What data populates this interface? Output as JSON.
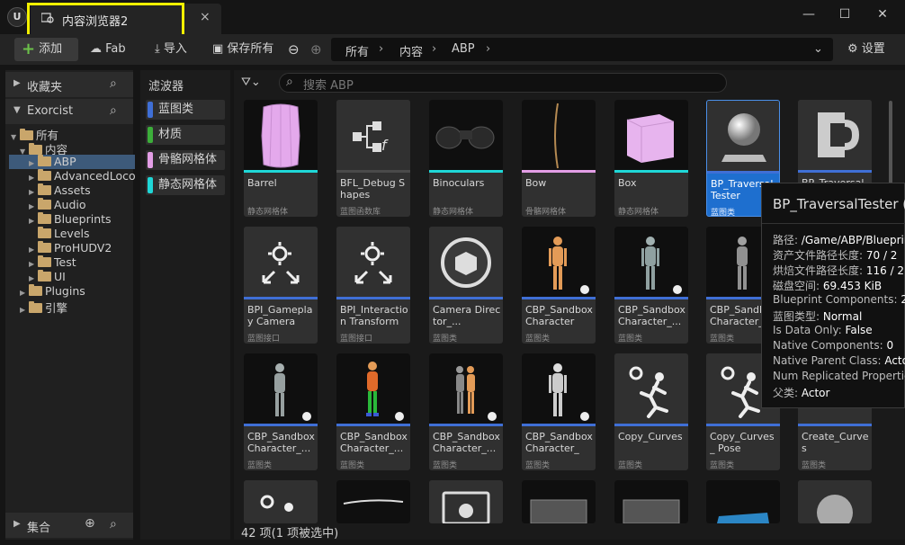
{
  "tab": {
    "label": "内容浏览器2",
    "close": "×"
  },
  "window": {
    "minimize": "—",
    "maximize": "☐",
    "close": "✕"
  },
  "toolbar": {
    "add": "添加",
    "fab": "Fab",
    "import": "导入",
    "save_all": "保存所有",
    "settings": "设置"
  },
  "breadcrumb": [
    "所有",
    "内容",
    "ABP"
  ],
  "left": {
    "favorites": "收藏夹",
    "project": "Exorcist",
    "tree": [
      "所有",
      "内容",
      "ABP",
      "AdvancedLoco",
      "Assets",
      "Audio",
      "Blueprints",
      "Levels",
      "ProHUDV2",
      "Test",
      "UI",
      "Plugins",
      "引擎"
    ],
    "collections": "集合"
  },
  "filters": {
    "title": "滤波器",
    "items": [
      {
        "label": "蓝图类",
        "color": "#3f6fd6"
      },
      {
        "label": "材质",
        "color": "#3cae3a"
      },
      {
        "label": "骨骼网格体",
        "color": "#e39ee6"
      },
      {
        "label": "静态网格体",
        "color": "#1fd7d7"
      }
    ]
  },
  "search": {
    "placeholder": "搜索 ABP"
  },
  "assets": [
    {
      "name": "Barrel",
      "type": "静态网格体"
    },
    {
      "name": "BFL_Debug Shapes",
      "type": "蓝图函数库"
    },
    {
      "name": "Binoculars",
      "type": "静态网格体"
    },
    {
      "name": "Bow",
      "type": "骨骼网格体"
    },
    {
      "name": "Box",
      "type": "静态网格体"
    },
    {
      "name": "BP_Traversal Tester",
      "type": "蓝图类"
    },
    {
      "name": "BP_Traversal",
      "type": ""
    },
    {
      "name": "BPI_Gameplay Camera",
      "type": "蓝图接口"
    },
    {
      "name": "BPI_Interaction Transform",
      "type": "蓝图接口"
    },
    {
      "name": "Camera Director_...",
      "type": "蓝图类"
    },
    {
      "name": "CBP_Sandbox Character",
      "type": "蓝图类"
    },
    {
      "name": "CBP_Sandbox Character_...",
      "type": "蓝图类"
    },
    {
      "name": "CBP_Sandbox Character_...",
      "type": "蓝图类"
    },
    {
      "name": "CBP_Sandbox Character_...",
      "type": "蓝图类"
    },
    {
      "name": "CBP_Sandbox Character_...",
      "type": "蓝图类"
    },
    {
      "name": "CBP_Sandbox Character_...",
      "type": "蓝图类"
    },
    {
      "name": "CBP_Sandbox Character_U...",
      "type": "蓝图类"
    },
    {
      "name": "Copy_Curves",
      "type": "蓝图类"
    },
    {
      "name": "Copy_Curves_ Pose",
      "type": "蓝图类"
    },
    {
      "name": "Create_Curves",
      "type": "蓝图类"
    }
  ],
  "tooltip": {
    "title": "BP_TraversalTester (",
    "rows": [
      {
        "k": "路径: ",
        "v": "/Game/ABP/Blueprin"
      },
      {
        "k": "资产文件路径长度: ",
        "v": "70 / 2"
      },
      {
        "k": "烘焙文件路径长度: ",
        "v": "116 / 2"
      },
      {
        "k": "磁盘空间: ",
        "v": "69.453 KiB"
      },
      {
        "k": "Blueprint Components: ",
        "v": "2"
      },
      {
        "k": "蓝图类型: ",
        "v": "Normal"
      },
      {
        "k": "Is Data Only: ",
        "v": "False"
      },
      {
        "k": "Native Components: ",
        "v": "0"
      },
      {
        "k": "Native Parent Class: ",
        "v": "Acto"
      },
      {
        "k": "Num Replicated Propertie",
        "v": ""
      },
      {
        "k": "父类: ",
        "v": "Actor"
      }
    ]
  },
  "status": "42 项(1 项被选中)"
}
